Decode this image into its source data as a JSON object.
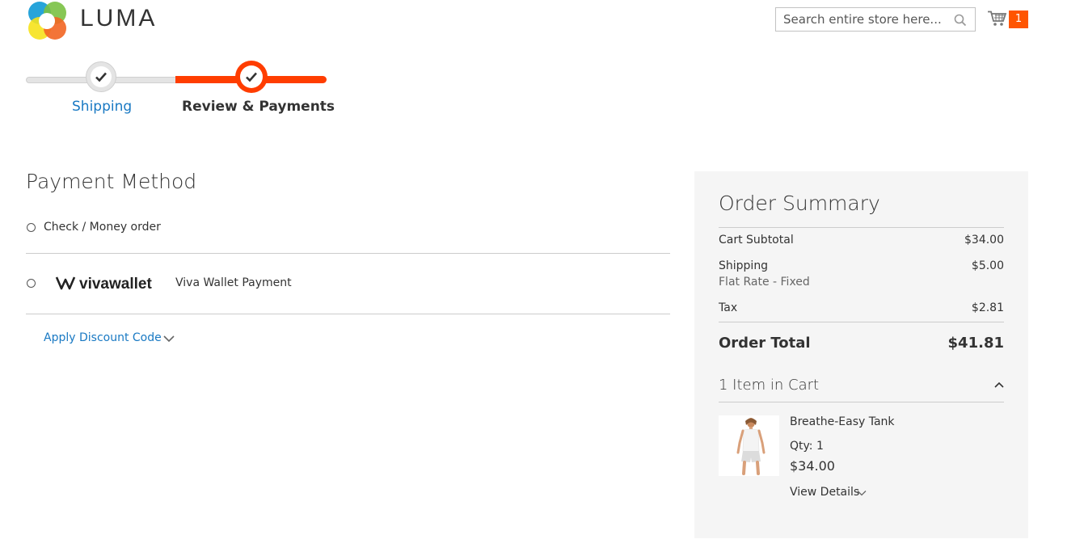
{
  "header": {
    "logo_text": "LUMA",
    "search_placeholder": "Search entire store here...",
    "cart_count": "1"
  },
  "progress": {
    "steps": [
      {
        "label": "Shipping",
        "state": "complete"
      },
      {
        "label": "Review & Payments",
        "state": "active"
      }
    ]
  },
  "payment": {
    "title": "Payment Method",
    "methods": [
      {
        "label": "Check / Money order"
      },
      {
        "label": "Viva Wallet Payment",
        "logo_text": "vivawallet"
      }
    ],
    "discount_label": "Apply Discount Code"
  },
  "summary": {
    "title": "Order Summary",
    "rows": [
      {
        "label": "Cart Subtotal",
        "value": "$34.00"
      },
      {
        "label": "Shipping",
        "sublabel": "Flat Rate - Fixed",
        "value": "$5.00"
      },
      {
        "label": "Tax",
        "value": "$2.81"
      }
    ],
    "total_label": "Order Total",
    "total_value": "$41.81",
    "items_label": "1 Item in Cart",
    "item": {
      "name": "Breathe-Easy Tank",
      "qty": "Qty: 1",
      "price": "$34.00",
      "view_details": "View Details"
    }
  },
  "colors": {
    "accent": "#ff3d00",
    "link": "#1979c3",
    "cart_badge": "#ff5501",
    "summary_bg": "#f5f5f5"
  }
}
